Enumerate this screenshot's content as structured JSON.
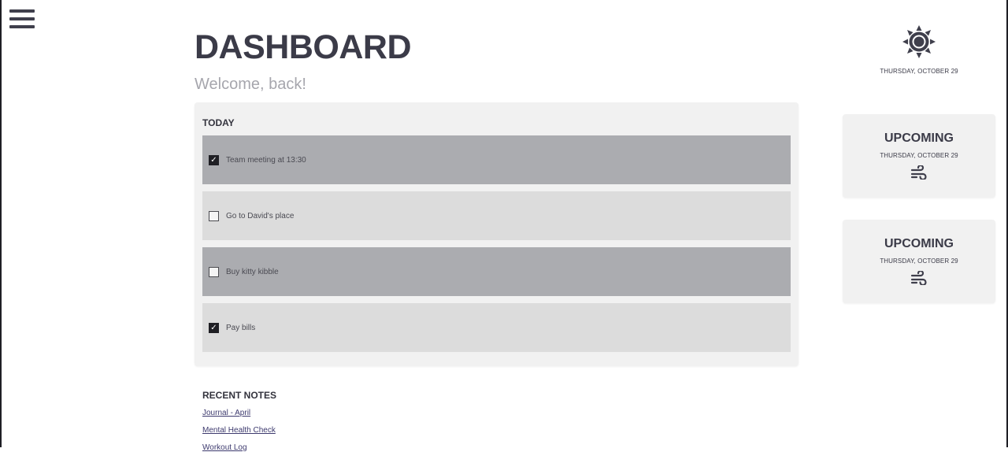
{
  "header": {
    "title": "DASHBOARD",
    "subtitle": "Welcome, back!"
  },
  "today": {
    "title": "TODAY",
    "tasks": [
      {
        "label": "Team meeting at 13:30",
        "checked": true
      },
      {
        "label": "Go to David's place",
        "checked": false
      },
      {
        "label": "Buy kitty kibble",
        "checked": false
      },
      {
        "label": "Pay bills",
        "checked": true
      }
    ]
  },
  "recent_notes": {
    "title": "RECENT NOTES",
    "items": [
      "Journal - April",
      "Mental Health Check",
      "Workout Log"
    ]
  },
  "weather": {
    "icon": "sun-icon",
    "date": "THURSDAY, OCTOBER 29"
  },
  "upcoming": [
    {
      "title": "UPCOMING",
      "date": "THURSDAY, OCTOBER 29",
      "icon": "wind-icon"
    },
    {
      "title": "UPCOMING",
      "date": "THURSDAY, OCTOBER 29",
      "icon": "wind-icon"
    }
  ],
  "colors": {
    "text_dark": "#3b3b48",
    "subtitle": "#a6a6ad",
    "card_bg": "#f1f1f1",
    "task_dark": "#abacb0",
    "task_light": "#dcdcdc",
    "link": "#3d3a6e"
  }
}
